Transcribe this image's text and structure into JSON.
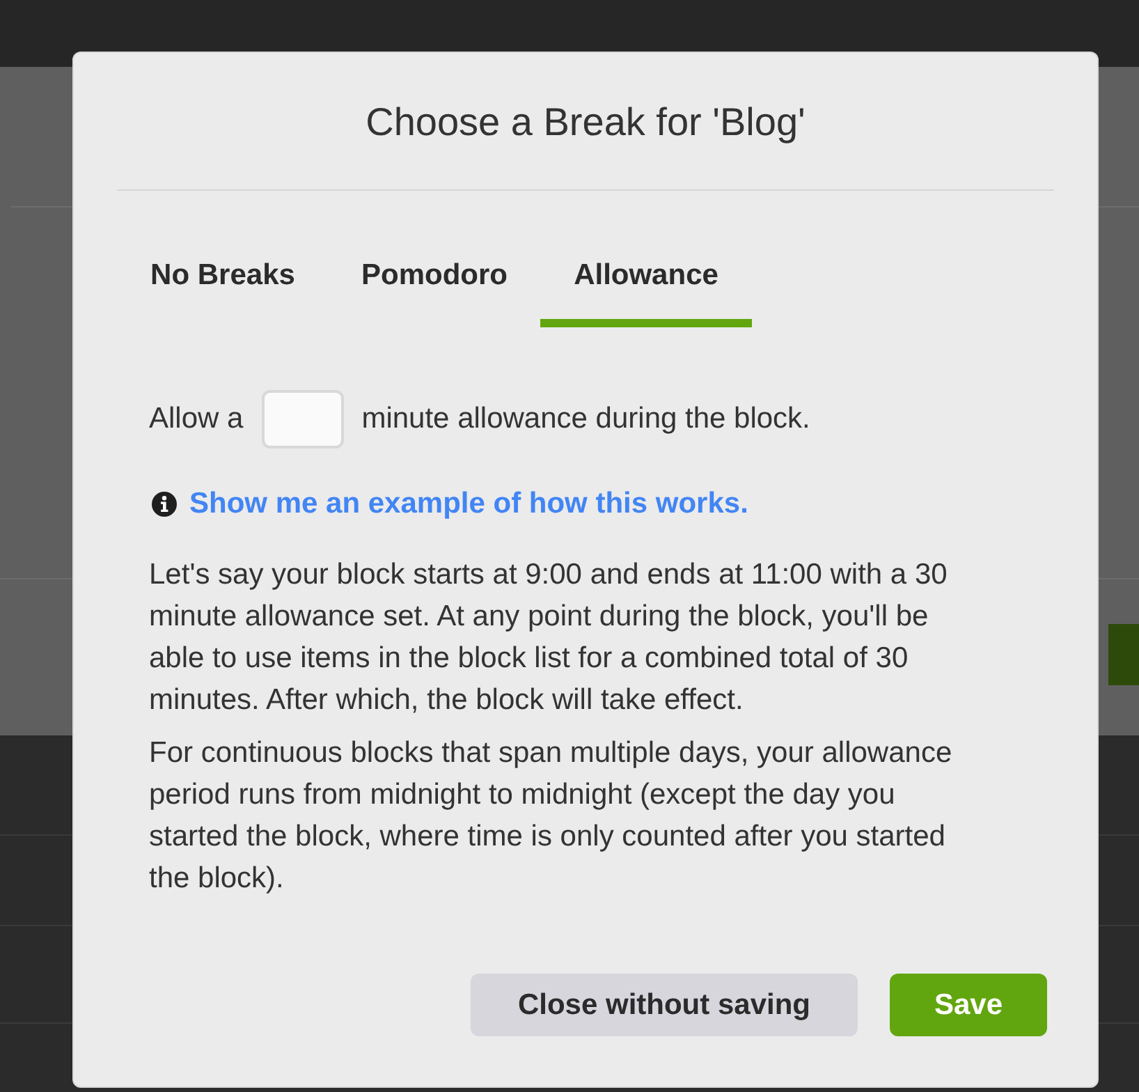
{
  "dialog": {
    "title": "Choose a Break for 'Blog'",
    "tabs": [
      {
        "label": "No Breaks",
        "selected": false
      },
      {
        "label": "Pomodoro",
        "selected": false
      },
      {
        "label": "Allowance",
        "selected": true
      }
    ],
    "allowance_row": {
      "prefix": "Allow a",
      "suffix": "minute allowance during the block."
    },
    "example_link": "Show me an example of how this works.",
    "paragraphs": [
      "Let's say your block starts at 9:00 and ends at 11:00 with a 30 minute allowance set. At any point during the block, you'll be able to use items in the block list for a combined total of 30 minutes. After which, the block will take effect.",
      "For continuous blocks that span multiple days, your allowance period runs from midnight to midnight (except the day you started the block, where time is only counted after you started the block)."
    ],
    "buttons": [
      {
        "label": "Close without saving",
        "kind": "secondary"
      },
      {
        "label": "Save",
        "kind": "primary"
      }
    ]
  }
}
